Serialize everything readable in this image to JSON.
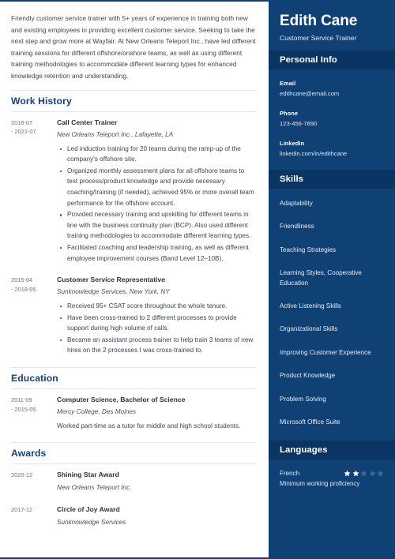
{
  "summary": "Friendly customer service trainer with 5+ years of experience in training both new and existing employees in providing excellent customer service. Seeking to take the next step and grow more at Wayfair. At New Orleans Teleport Inc., have led different training sessions for different offshore/onshore teams, as well as using different training methodologies to accommodate different learning types for enhanced knowledge retention and understanding.",
  "sections": {
    "work_history": {
      "heading": "Work History",
      "entries": [
        {
          "date_start": "2018-07",
          "date_end": "- 2021-07",
          "title": "Call Center Trainer",
          "subtitle": "New Orleans Teleport Inc., Lafayette, LA",
          "bullets": [
            "Led induction training for 20 teams during the ramp-up of the company's offshore site.",
            "Organized monthly assessment plans for all offshore teams to test process/product knowledge and provide necessary coaching/training (if needed), achieved 95% or more overall team performance for the offshore account.",
            "Provided necessary training and upskilling for different teams in line with the business continuity plan (BCP). Also used different training methodologies to accommodate different learning types.",
            "Facilitated coaching and leadership training, as well as different employee improvement courses (Band Level 12–10B)."
          ]
        },
        {
          "date_start": "2015-04",
          "date_end": "- 2018-05",
          "title": "Customer Service Representative",
          "subtitle": "Sunknowledge Services, New York, NY",
          "bullets": [
            "Received 95+ CSAT score throughout the whole tenure.",
            "Have been cross-trained to 2 different processes to provide support during high volume of calls.",
            "Became an assistant process trainer to help train 3 teams of new hires on the 2 processes I was cross-trained to."
          ]
        }
      ]
    },
    "education": {
      "heading": "Education",
      "entries": [
        {
          "date_start": "2011-09",
          "date_end": "- 2015-05",
          "title": "Computer Science, Bachelor of Science",
          "subtitle": "Mercy College, Des Moines",
          "description": "Worked part-time as a tutor for middle and high school students."
        }
      ]
    },
    "awards": {
      "heading": "Awards",
      "entries": [
        {
          "date_start": "2020-12",
          "date_end": "",
          "title": "Shining Star Award",
          "subtitle": "New Orleans Teleport Inc."
        },
        {
          "date_start": "2017-12",
          "date_end": "",
          "title": "Circle of Joy Award",
          "subtitle": "Sunknowledge Services"
        }
      ]
    }
  },
  "sidebar": {
    "name": "Edith Cane",
    "role": "Customer Service Trainer",
    "personal_info": {
      "heading": "Personal Info",
      "items": [
        {
          "label": "Email",
          "value": "edithcane@email.com"
        },
        {
          "label": "Phone",
          "value": "123-456-7890"
        },
        {
          "label": "LinkedIn",
          "value": "linkedin.com/in/edithcane"
        }
      ]
    },
    "skills": {
      "heading": "Skills",
      "items": [
        "Adaptability",
        "Friendliness",
        "Teaching Strategies",
        "Learning Styles, Cooperative Education",
        "Active Listening Skills",
        "Organizational Skills",
        "Improving Customer Experience",
        "Product Knowledge",
        "Problem Solving",
        "Microsoft Office Suite"
      ]
    },
    "languages": {
      "heading": "Languages",
      "items": [
        {
          "name": "French",
          "rating": 2,
          "max_rating": 5,
          "level": "Minimum working proficiency"
        }
      ]
    }
  },
  "colors": {
    "sidebar_bg": "#0f4175",
    "sidebar_bar_bg": "#0a3463",
    "heading_blue": "#16427c",
    "body_text": "#3f4450",
    "star_filled": "#ffffff",
    "star_empty": "#3d6a9c"
  }
}
